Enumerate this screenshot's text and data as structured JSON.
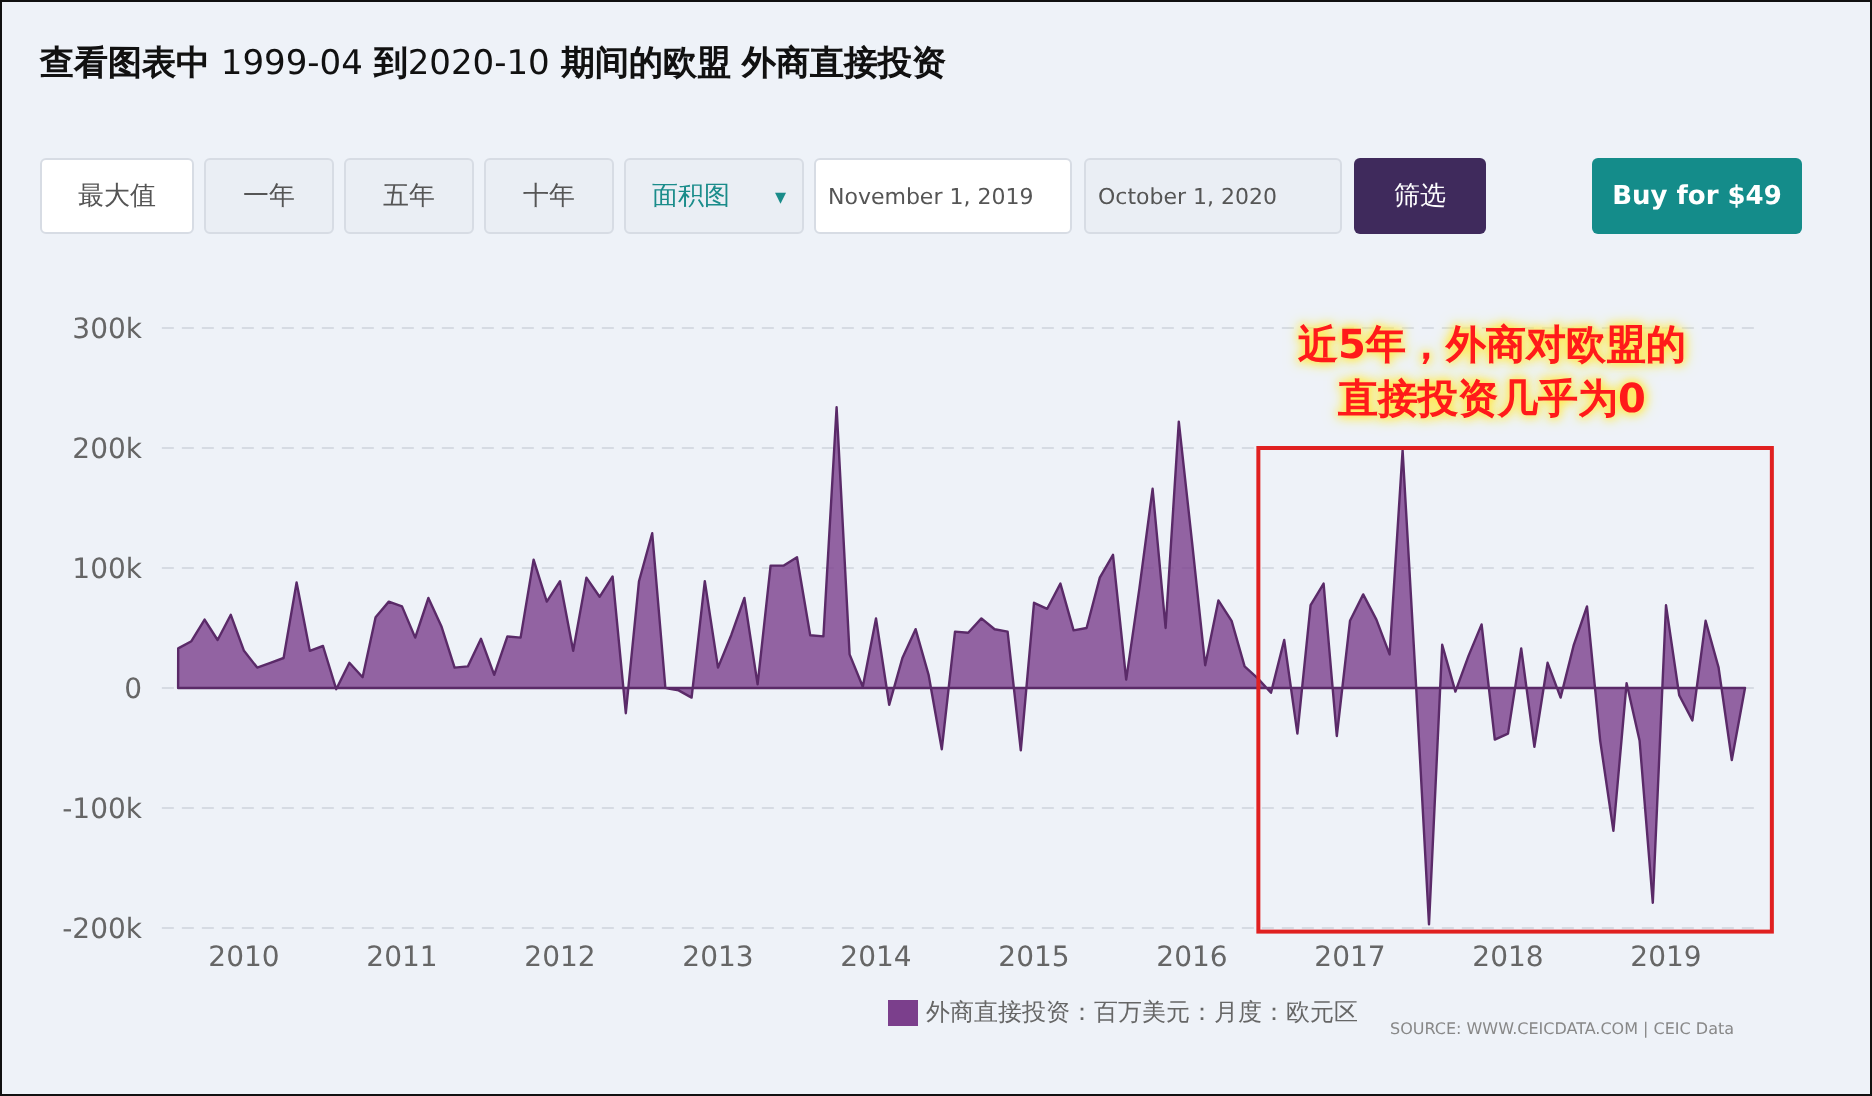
{
  "title": "**查看图表中** 1999-04 **到**2020-10 **期间的欧盟 外商直接投资**",
  "toolbar": {
    "ranges": [
      {
        "label": "最大值",
        "selected": true
      },
      {
        "label": "一年",
        "selected": false
      },
      {
        "label": "五年",
        "selected": false
      },
      {
        "label": "十年",
        "selected": false
      }
    ],
    "chart_type": {
      "value": "面积图",
      "arrow": "▾"
    },
    "date_fields": [
      {
        "value": "November 1, 2019",
        "selected": true
      },
      {
        "value": "October 1, 2020",
        "selected": false
      }
    ],
    "filter_button": "筛选",
    "buy_button": "Buy for $49"
  },
  "chart": {
    "chart_data": {
      "type": "area",
      "x": [
        2009.583,
        2009.667,
        2009.75,
        2009.833,
        2009.917,
        2010,
        2010.083,
        2010.167,
        2010.25,
        2010.333,
        2010.417,
        2010.5,
        2010.583,
        2010.667,
        2010.75,
        2010.833,
        2010.917,
        2011,
        2011.083,
        2011.167,
        2011.25,
        2011.333,
        2011.417,
        2011.5,
        2011.583,
        2011.667,
        2011.75,
        2011.833,
        2011.917,
        2012,
        2012.083,
        2012.167,
        2012.25,
        2012.333,
        2012.417,
        2012.5,
        2012.583,
        2012.667,
        2012.75,
        2012.833,
        2012.917,
        2013,
        2013.083,
        2013.167,
        2013.25,
        2013.333,
        2013.417,
        2013.5,
        2013.583,
        2013.667,
        2013.75,
        2013.833,
        2013.917,
        2014,
        2014.083,
        2014.167,
        2014.25,
        2014.333,
        2014.417,
        2014.5,
        2014.583,
        2014.667,
        2014.75,
        2014.833,
        2014.917,
        2015,
        2015.083,
        2015.167,
        2015.25,
        2015.333,
        2015.417,
        2015.5,
        2015.583,
        2015.667,
        2015.75,
        2015.833,
        2015.917,
        2016,
        2016.083,
        2016.167,
        2016.25,
        2016.333,
        2016.417,
        2016.5,
        2016.583,
        2016.667,
        2016.75,
        2016.833,
        2016.917,
        2017,
        2017.083,
        2017.167,
        2017.25,
        2017.333,
        2017.417,
        2017.5,
        2017.583,
        2017.667,
        2017.75,
        2017.833,
        2017.917,
        2018,
        2018.083,
        2018.167,
        2018.25,
        2018.333,
        2018.417,
        2018.5,
        2018.583,
        2018.667,
        2018.75,
        2018.833,
        2018.917,
        2019,
        2019.083,
        2019.167,
        2019.25,
        2019.333,
        2019.417,
        2019.5
      ],
      "series": [
        {
          "name": "外商直接投资：百万美元：月度：欧元区",
          "color": "#7b3f8c",
          "values": [
            33000,
            39000,
            57000,
            40000,
            61000,
            31000,
            17000,
            21000,
            25000,
            88000,
            31000,
            35000,
            -1000,
            21000,
            9000,
            59000,
            72000,
            68000,
            42000,
            75000,
            51000,
            17000,
            18000,
            41000,
            11000,
            43000,
            42000,
            107000,
            72000,
            89000,
            31000,
            92000,
            76000,
            93000,
            -21000,
            89000,
            129000,
            0,
            -2000,
            -8000,
            89000,
            17000,
            44000,
            75000,
            3000,
            102000,
            102000,
            109000,
            44000,
            43000,
            234000,
            28000,
            1000,
            58000,
            -14000,
            25000,
            49000,
            11000,
            -51000,
            47000,
            46000,
            58000,
            49000,
            47000,
            -52000,
            71000,
            66000,
            87000,
            48000,
            50000,
            92000,
            111000,
            7000,
            83000,
            166000,
            50000,
            222000,
            122000,
            19000,
            73000,
            56000,
            18000,
            8000,
            -4000,
            40000,
            -38000,
            69000,
            87000,
            -40000,
            56000,
            78000,
            57000,
            28000,
            198000,
            6000,
            -197000,
            36000,
            -3000,
            27000,
            53000,
            -43000,
            -38000,
            33000,
            -49000,
            21000,
            -8000,
            36000,
            68000,
            -44000,
            -119000,
            4000,
            -44000,
            -179000,
            69000,
            -6000,
            -27000,
            56000,
            17000,
            -60000,
            0
          ]
        }
      ],
      "ylim": [
        -200000,
        300000
      ],
      "yticks": [
        {
          "value": 300000,
          "label": "300k"
        },
        {
          "value": 200000,
          "label": "200k"
        },
        {
          "value": 100000,
          "label": "100k"
        },
        {
          "value": 0,
          "label": "0"
        },
        {
          "value": -100000,
          "label": "-100k"
        },
        {
          "value": -200000,
          "label": "-200k"
        }
      ],
      "xticks": [
        {
          "value": 2010,
          "label": "2010"
        },
        {
          "value": 2011,
          "label": "2011"
        },
        {
          "value": 2012,
          "label": "2012"
        },
        {
          "value": 2013,
          "label": "2013"
        },
        {
          "value": 2014,
          "label": "2014"
        },
        {
          "value": 2015,
          "label": "2015"
        },
        {
          "value": 2016,
          "label": "2016"
        },
        {
          "value": 2017,
          "label": "2017"
        },
        {
          "value": 2018,
          "label": "2018"
        },
        {
          "value": 2019,
          "label": "2019"
        }
      ],
      "xlim": [
        2009.48,
        2019.58
      ],
      "grid": true,
      "annotations": [
        "近5年，外商对欧盟的",
        "直接投资几乎为0"
      ]
    },
    "highlight": {
      "color": "#e02020"
    },
    "source": "SOURCE: WWW.CEICDATA.COM | CEIC Data"
  }
}
